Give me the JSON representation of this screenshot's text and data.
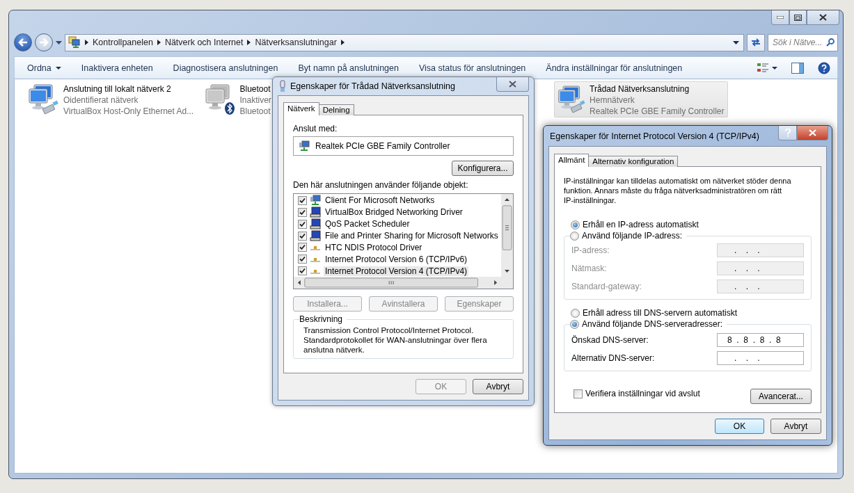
{
  "explorer": {
    "breadcrumb": [
      "Kontrollpanelen",
      "Nätverk och Internet",
      "Nätverksanslutningar"
    ],
    "search": {
      "placeholder": "Sök i Nätve..."
    },
    "toolbar": [
      {
        "label": "Ordna",
        "kind": "menu"
      },
      {
        "label": "Inaktivera enheten",
        "kind": "command"
      },
      {
        "label": "Diagnostisera anslutningen",
        "kind": "command"
      },
      {
        "label": "Byt namn på anslutningen",
        "kind": "command"
      },
      {
        "label": "Visa status för anslutningen",
        "kind": "command"
      },
      {
        "label": "Ändra inställningar för anslutningen",
        "kind": "command"
      }
    ],
    "connections": [
      {
        "name": "Anslutning till lokalt nätverk 2",
        "status": "Oidentifierat nätverk",
        "adapter": "VirtualBox Host-Only Ethernet Ad...",
        "kind": "lan",
        "selected": false
      },
      {
        "name": "Bluetoot",
        "status": "Inaktiver",
        "adapter": "Bluetoot",
        "kind": "bluetooth",
        "selected": false
      },
      {
        "name": "Trådad Nätverksanslutning",
        "status": "Hemnätverk",
        "adapter": "Realtek PCIe GBE Family Controller",
        "kind": "lan",
        "selected": true
      }
    ]
  },
  "adapter_dialog": {
    "title": "Egenskaper för Trådad Nätverksanslutning",
    "tabs": [
      {
        "label": "Nätverk",
        "selected": true
      },
      {
        "label": "Delning",
        "selected": false
      }
    ],
    "connect_label": "Anslut med:",
    "adapter": "Realtek PCIe GBE Family Controller",
    "configure_button": "Konfigurera...",
    "items_label": "Den här anslutningen använder följande objekt:",
    "items": [
      {
        "label": "Client For Microsoft Networks",
        "kind": "client",
        "checked": true,
        "selected": false
      },
      {
        "label": "VirtualBox Bridged Networking Driver",
        "kind": "service",
        "checked": true,
        "selected": false
      },
      {
        "label": "QoS Packet Scheduler",
        "kind": "service",
        "checked": true,
        "selected": false
      },
      {
        "label": "File and Printer Sharing for Microsoft Networks",
        "kind": "service",
        "checked": true,
        "selected": false
      },
      {
        "label": "HTC NDIS Protocol Driver",
        "kind": "protocol",
        "checked": true,
        "selected": false
      },
      {
        "label": "Internet Protocol Version 6 (TCP/IPv6)",
        "kind": "protocol",
        "checked": true,
        "selected": false
      },
      {
        "label": "Internet Protocol Version 4 (TCP/IPv4)",
        "kind": "protocol",
        "checked": true,
        "selected": true
      }
    ],
    "actions": [
      {
        "label": "Installera...",
        "disabled": true
      },
      {
        "label": "Avinstallera",
        "disabled": true
      },
      {
        "label": "Egenskaper",
        "disabled": true
      }
    ],
    "description": {
      "title": "Beskrivning",
      "text": "Transmission Control Protocol/Internet Protocol. Standardprotokollet för WAN-anslutningar över flera anslutna nätverk."
    },
    "buttons": [
      {
        "label": "OK",
        "disabled": true
      },
      {
        "label": "Avbryt",
        "disabled": false
      }
    ]
  },
  "ipv4_dialog": {
    "title": "Egenskaper för Internet Protocol Version 4 (TCP/IPv4)",
    "tabs": [
      {
        "label": "Allmänt",
        "selected": true
      },
      {
        "label": "Alternativ konfiguration",
        "selected": false
      }
    ],
    "intro": "IP-inställningar kan tilldelas automatiskt om nätverket stöder denna funktion. Annars måste du fråga nätverksadministratören om rätt IP-inställningar.",
    "ip_auto": {
      "label": "Erhåll en IP-adress automatiskt",
      "selected": true
    },
    "ip_manual": {
      "label": "Använd följande IP-adress:",
      "selected": false,
      "fields": [
        {
          "label": "IP-adress:",
          "value": "   .    .    .",
          "disabled": true
        },
        {
          "label": "Nätmask:",
          "value": "   .    .    .",
          "disabled": true
        },
        {
          "label": "Standard-gateway:",
          "value": "   .    .    .",
          "disabled": true
        }
      ]
    },
    "dns_auto": {
      "label": "Erhåll adress till DNS-servern automatiskt",
      "selected": false
    },
    "dns_manual": {
      "label": "Använd följande DNS-serveradresser:",
      "selected": true,
      "fields": [
        {
          "label": "Önskad DNS-server:",
          "value": "8  .  8  .  8  .  8",
          "disabled": false
        },
        {
          "label": "Alternativ DNS-server:",
          "value": "   .    .    .",
          "disabled": false
        }
      ]
    },
    "verify": {
      "label": "Verifiera inställningar vid avslut",
      "checked": false
    },
    "advanced_button": "Avancerat...",
    "buttons": [
      {
        "label": "OK",
        "kind": "default"
      },
      {
        "label": "Avbryt",
        "kind": "normal"
      }
    ]
  }
}
